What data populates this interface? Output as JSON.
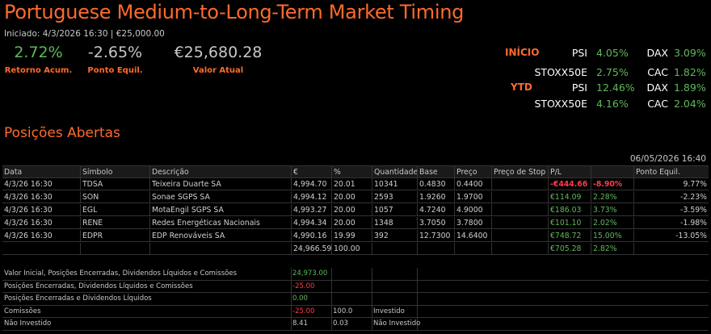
{
  "header": {
    "title": "Portuguese Medium-to-Long-Term Market Timing",
    "subtitle": "Iniciado: 4/3/2026 16:30 | €25,000.00"
  },
  "kpis": [
    {
      "value": "2.72%",
      "label": "Retorno Acum.",
      "color": "#5fb95a"
    },
    {
      "value": "-2.65%",
      "label": "Ponto Equil.",
      "color": "#c8c8c8"
    },
    {
      "value": "€25,680.28",
      "label": "Valor Atual",
      "color": "#c8c8c8"
    }
  ],
  "markets": {
    "inicio_label": "INÍCIO",
    "ytd_label": "YTD",
    "inicio": [
      {
        "name": "PSI",
        "value": "4.05%",
        "name2": "DAX",
        "value2": "3.09%"
      },
      {
        "name": "STOXX50E",
        "value": "2.75%",
        "name2": "CAC",
        "value2": "1.82%"
      }
    ],
    "ytd": [
      {
        "name": "PSI",
        "value": "12.46%",
        "name2": "DAX",
        "value2": "1.89%"
      },
      {
        "name": "STOXX50E",
        "value": "4.16%",
        "name2": "CAC",
        "value2": "2.04%"
      }
    ]
  },
  "positions": {
    "section_title": "Posições Abertas",
    "timestamp": "06/05/2026 16:40",
    "columns": [
      "Data",
      "Símbolo",
      "Descrição",
      "€",
      "%",
      "Quantidade",
      "Base",
      "Preço",
      "Preço de Stop",
      "P/L",
      "",
      "Ponto Equil."
    ],
    "rows": [
      {
        "data": "4/3/26 16:30",
        "simbolo": "TDSA",
        "descricao": "Teixeira Duarte SA",
        "eur": "4,994.70",
        "pct": "20.01",
        "qtd": "10341",
        "base": "0.4830",
        "preco": "0.4400",
        "stop": "",
        "pl": "-€444.66",
        "plpct": "-8.90%",
        "equil": "9.77%",
        "neg": true
      },
      {
        "data": "4/3/26 16:30",
        "simbolo": "SON",
        "descricao": "Sonae SGPS SA",
        "eur": "4,994.12",
        "pct": "20.00",
        "qtd": "2593",
        "base": "1.9260",
        "preco": "1.9700",
        "stop": "",
        "pl": "€114.09",
        "plpct": "2.28%",
        "equil": "-2.23%",
        "neg": false
      },
      {
        "data": "4/3/26 16:30",
        "simbolo": "EGL",
        "descricao": "MotaEngil SGPS SA",
        "eur": "4,993.27",
        "pct": "20.00",
        "qtd": "1057",
        "base": "4.7240",
        "preco": "4.9000",
        "stop": "",
        "pl": "€186.03",
        "plpct": "3.73%",
        "equil": "-3.59%",
        "neg": false
      },
      {
        "data": "4/3/26 16:30",
        "simbolo": "RENE",
        "descricao": "Redes Energéticas Nacionais",
        "eur": "4,994.34",
        "pct": "20.00",
        "qtd": "1348",
        "base": "3.7050",
        "preco": "3.7800",
        "stop": "",
        "pl": "€101.10",
        "plpct": "2.02%",
        "equil": "-1.98%",
        "neg": false
      },
      {
        "data": "4/3/26 16:30",
        "simbolo": "EDPR",
        "descricao": "EDP Renováveis SA",
        "eur": "4,990.16",
        "pct": "19.99",
        "qtd": "392",
        "base": "12.7300",
        "preco": "14.6400",
        "stop": "",
        "pl": "€748.72",
        "plpct": "15.00%",
        "equil": "-13.05%",
        "neg": false
      }
    ],
    "totals": {
      "eur": "24,966.59",
      "pct": "100.00",
      "pl": "€705.28",
      "plpct": "2.82%"
    }
  },
  "summary": [
    {
      "label": "Valor Inicial, Posições Encerradas, Dividendos Líquidos e Comissões",
      "value": "24,973.00",
      "color": "#5fb95a",
      "c2": "",
      "c3": ""
    },
    {
      "label": "Posições Encerradas, Dividendos Líquidos e Comissões",
      "value": "-25.00",
      "color": "#ff3b4a",
      "c2": "",
      "c3": ""
    },
    {
      "label": "Posições Encerradas e Dividendos Líquidos",
      "value": "0.00",
      "color": "#5fb95a",
      "c2": "",
      "c3": ""
    },
    {
      "label": "Comissões",
      "value": "-25.00",
      "color": "#ff3b4a",
      "c2": "100.0",
      "c3": "Investido"
    },
    {
      "label": "Não Investido",
      "value": "8.41",
      "color": "#c8c8c8",
      "c2": "0.03",
      "c3": "Não Investido"
    }
  ]
}
